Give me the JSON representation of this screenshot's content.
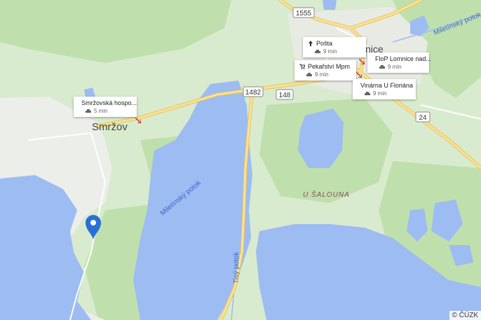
{
  "map": {
    "towns": {
      "smrzov": "Smržov",
      "lomnice": "nice"
    },
    "locality": "U ŠALOUNA",
    "water": {
      "miletinsky_main": "Miletínský potok",
      "miletinsky_ne": "Miletínský potok",
      "tisy": "Tisý potok"
    },
    "roads": {
      "r1555": "1555",
      "r1482": "1482",
      "r148": "148",
      "r24": "24"
    }
  },
  "pois": {
    "smrzovska": {
      "name": "Smržovská hospo...",
      "time": "5 min",
      "icon": "restaurant-icon"
    },
    "posta": {
      "name": "Pošta",
      "time": "9 min",
      "icon": "post-icon"
    },
    "pekarstvi": {
      "name": "Pekařství Mpm",
      "time": "9 min",
      "icon": "shop-icon"
    },
    "flop": {
      "name": "FloP Lomnice nad...",
      "time": "9 min",
      "icon": "shop-icon"
    },
    "vinarna": {
      "name": "Vinárna U Floriána",
      "time": "9 min",
      "icon": "shop-icon"
    }
  },
  "copyright": "© ČÚZK",
  "colors": {
    "water": "#9dbcf2",
    "land": "#d9ebce",
    "forest": "#bedfac",
    "urban": "#eceeea",
    "road_major": "#f6d77a",
    "pin": "#2a6fd8"
  }
}
